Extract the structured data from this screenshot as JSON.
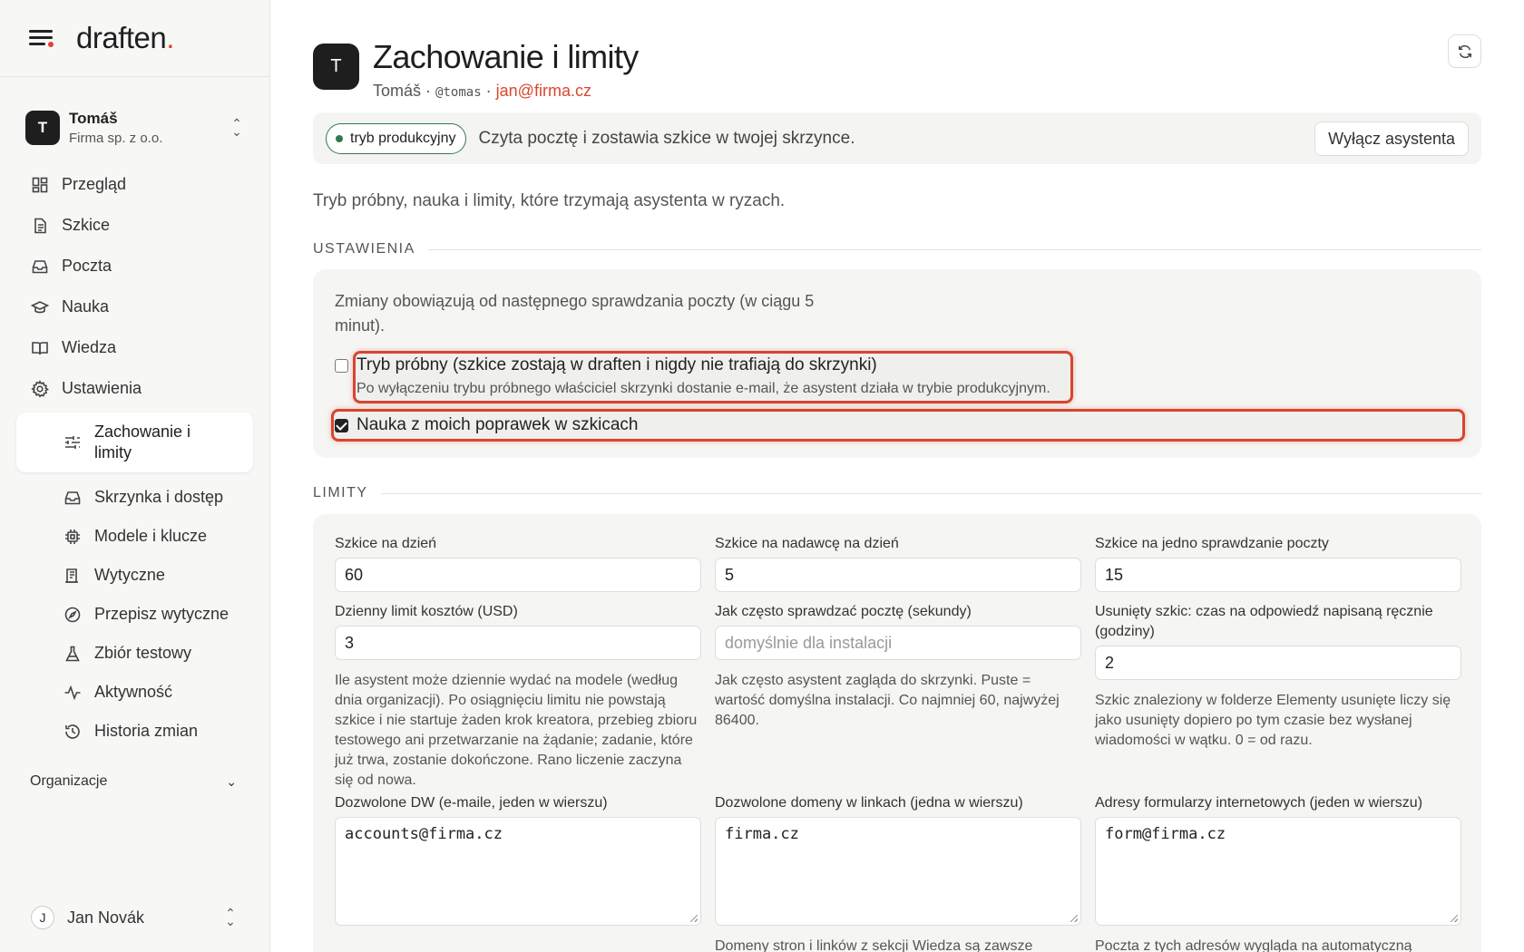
{
  "app": {
    "logo": "draften",
    "logo_dot": "."
  },
  "account": {
    "initial": "T",
    "name": "Tomáš",
    "org": "Firma sp. z o.o."
  },
  "nav": [
    {
      "label": "Przegląd",
      "icon": "dashboard-icon"
    },
    {
      "label": "Szkice",
      "icon": "document-icon"
    },
    {
      "label": "Poczta",
      "icon": "inbox-icon"
    },
    {
      "label": "Nauka",
      "icon": "graduation-cap-icon"
    },
    {
      "label": "Wiedza",
      "icon": "book-icon"
    },
    {
      "label": "Ustawienia",
      "icon": "gear-icon"
    }
  ],
  "subnav": [
    {
      "label": "Zachowanie i limity",
      "icon": "sliders-icon",
      "active": true
    },
    {
      "label": "Skrzynka i dostęp",
      "icon": "inbox-icon"
    },
    {
      "label": "Modele i klucze",
      "icon": "chip-icon"
    },
    {
      "label": "Wytyczne",
      "icon": "guidelines-icon"
    },
    {
      "label": "Przepisz wytyczne",
      "icon": "compass-icon"
    },
    {
      "label": "Zbiór testowy",
      "icon": "flask-icon"
    },
    {
      "label": "Aktywność",
      "icon": "activity-icon"
    },
    {
      "label": "Historia zmian",
      "icon": "history-icon"
    }
  ],
  "organizations": {
    "label": "Organizacje"
  },
  "user": {
    "initial": "J",
    "name": "Jan Novák"
  },
  "header": {
    "initial": "T",
    "title": "Zachowanie i limity",
    "name": "Tomáš",
    "sep": "·",
    "handle": "@tomas",
    "email": "jan@firma.cz"
  },
  "banner": {
    "mode": "tryb produkcyjny",
    "text": "Czyta pocztę i zostawia szkice w twojej skrzynce.",
    "button": "Wyłącz asystenta"
  },
  "intro": "Tryb próbny, nauka i limity, które trzymają asystenta w ryzach.",
  "settings": {
    "heading": "USTAWIENIA",
    "note": "Zmiany obowiązują od następnego sprawdzania poczty (w ciągu 5 minut).",
    "trial": {
      "label": "Tryb próbny (szkice zostają w draften i nigdy nie trafiają do skrzynki)",
      "help": "Po wyłączeniu trybu próbnego właściciel skrzynki dostanie e-mail, że asystent działa w trybie produkcyjnym.",
      "checked": false
    },
    "learning": {
      "label": "Nauka z moich poprawek w szkicach",
      "checked": true
    }
  },
  "limits": {
    "heading": "LIMITY",
    "drafts_per_day": {
      "label": "Szkice na dzień",
      "value": "60"
    },
    "drafts_per_sender": {
      "label": "Szkice na nadawcę na dzień",
      "value": "5"
    },
    "drafts_per_check": {
      "label": "Szkice na jedno sprawdzanie poczty",
      "value": "15"
    },
    "daily_cost": {
      "label": "Dzienny limit kosztów (USD)",
      "value": "3",
      "help": "Ile asystent może dziennie wydać na modele (według dnia organizacji). Po osiągnięciu limitu nie powstają szkice i nie startuje żaden krok kreatora, przebieg zbioru testowego ani przetwarzanie na żądanie; zadanie, które już trwa, zostanie dokończone. Rano liczenie zaczyna się od nowa."
    },
    "check_interval": {
      "label": "Jak często sprawdzać pocztę (sekundy)",
      "placeholder": "domyślnie dla instalacji",
      "help": "Jak często asystent zagląda do skrzynki. Puste = wartość domyślna instalacji. Co najmniej 60, najwyżej 86400."
    },
    "deleted_draft": {
      "label": "Usunięty szkic: czas na odpowiedź napisaną ręcznie (godziny)",
      "value": "2",
      "help": "Szkic znaleziony w folderze Elementy usunięte liczy się jako usunięty dopiero po tym czasie bez wysłanej wiadomości w wątku. 0 = od razu."
    },
    "allowed_cc": {
      "label": "Dozwolone DW (e-maile, jeden w wierszu)",
      "value": "accounts@firma.cz"
    },
    "allowed_domains": {
      "label": "Dozwolone domeny w linkach (jedna w wierszu)",
      "value": "firma.cz",
      "help": "Domeny stron i linków z sekcji Wiedza są zawsze"
    },
    "web_forms": {
      "label": "Adresy formularzy internetowych (jeden w wierszu)",
      "value": "form@firma.cz",
      "help": "Poczta z tych adresów wygląda na automatyczną"
    }
  },
  "colors": {
    "accent": "#e5412b",
    "production": "#2f7a4c",
    "highlight": "#d8452e"
  }
}
